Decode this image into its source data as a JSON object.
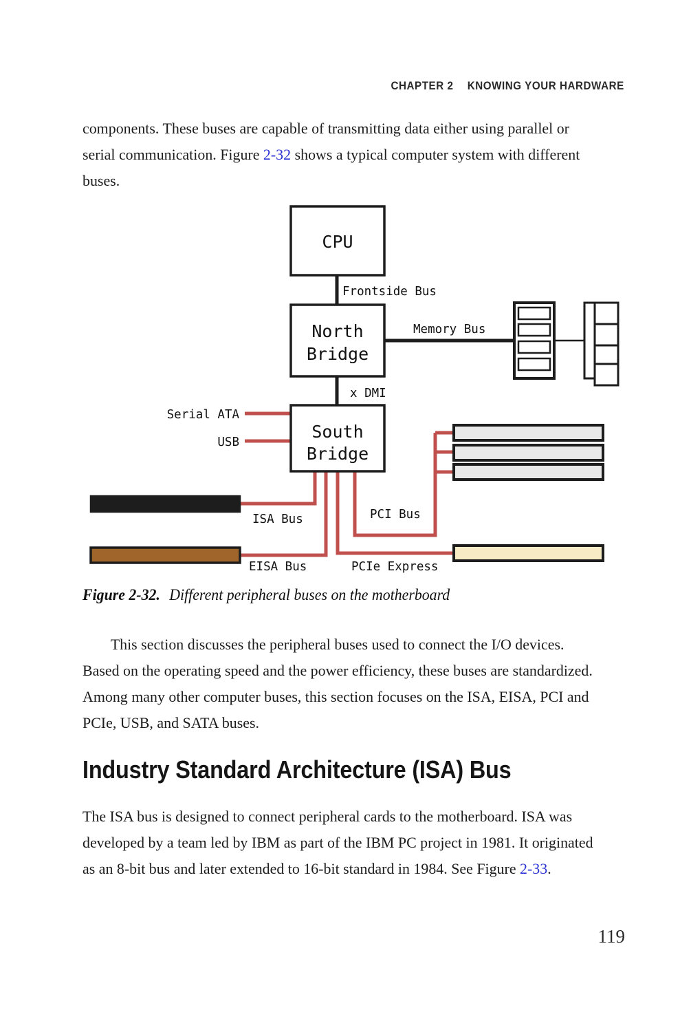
{
  "page": {
    "running_head_chapter": "CHAPTER 2",
    "running_head_title": "KNOWING YOUR HARDWARE",
    "folio": "119"
  },
  "paragraphs": {
    "top": {
      "part1": "components. These buses are capable of transmitting data either using parallel or serial communication. Figure ",
      "link": "2-32",
      "part2": " shows a typical computer system with different buses."
    },
    "middle": {
      "text": "This section discusses the peripheral buses used to connect the I/O devices. Based on the operating speed and the power efficiency, these buses are standardized. Among many other computer buses, this section focuses on the ISA, EISA, PCI and PCIe, USB, and SATA buses."
    },
    "bottom": {
      "part1": "The ISA bus is designed to connect peripheral cards to the motherboard. ISA was developed by a team led by IBM as part of the IBM PC project in 1981. It originated as an 8-bit bus and later extended to 16-bit standard in 1984. See Figure ",
      "link": "2-33",
      "part2": "."
    }
  },
  "heading": {
    "text": "Industry Standard Architecture (ISA) Bus"
  },
  "figure": {
    "caption_number": "Figure 2-32.",
    "caption_text": "Different peripheral buses on the motherboard",
    "blocks": {
      "cpu": "CPU",
      "north_bridge_line1": "North",
      "north_bridge_line2": "Bridge",
      "south_bridge_line1": "South",
      "south_bridge_line2": "Bridge"
    },
    "labels": {
      "frontside_bus": "Frontside Bus",
      "memory_bus": "Memory Bus",
      "dmi": "x DMI",
      "serial_ata": "Serial ATA",
      "usb": "USB",
      "isa_bus": "ISA Bus",
      "eisa_bus": "EISA Bus",
      "pci_bus": "PCI Bus",
      "pcie_express": "PCIe Express"
    },
    "colors": {
      "connector_red": "#c0504d",
      "line_black": "#1d1d1d",
      "isa_slot": "#1d1d1d",
      "eisa_slot": "#a0652b",
      "pci_slot": "#e9e9e9",
      "pcie_slot": "#f6ebc4",
      "link_blue": "#2b33d4"
    }
  }
}
